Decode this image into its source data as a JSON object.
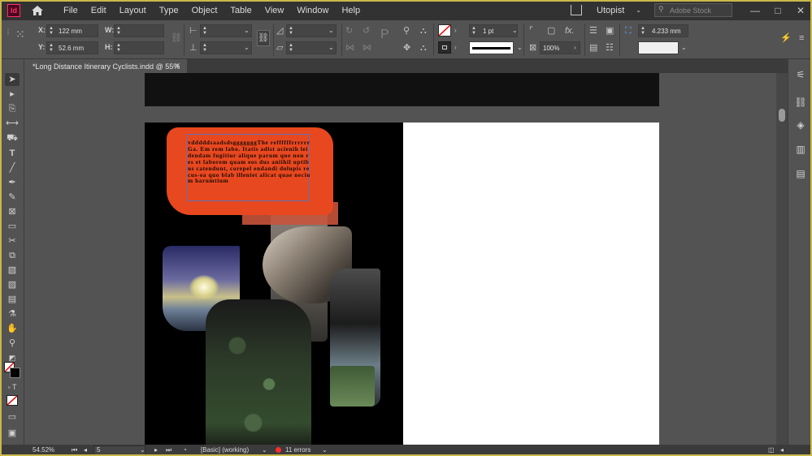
{
  "app": {
    "logo": "Id"
  },
  "menus": [
    "File",
    "Edit",
    "Layout",
    "Type",
    "Object",
    "Table",
    "View",
    "Window",
    "Help"
  ],
  "menubar_right": {
    "workspace": "Utopist",
    "stock_search_placeholder": "Adobe Stock",
    "window_buttons": [
      "—",
      "□",
      "✕"
    ]
  },
  "control_bar": {
    "x_label": "X:",
    "x_value": "122 mm",
    "y_label": "Y:",
    "y_value": "52.6 mm",
    "w_label": "W:",
    "w_value": "",
    "h_label": "H:",
    "h_value": "",
    "stroke_weight": "1 pt",
    "scale_percent": "100%",
    "offset_value": "4.233 mm"
  },
  "tab": {
    "title": "*Long Distance Itinerary Cyclists.indd @ 55%",
    "close": "✕"
  },
  "document": {
    "body_text": "vdddddsaadsdsgggggggThe reffffffrrrrrrGa. Em rem labo. Itatis adist acienih leidendam fugitiur alique parum que non res et laborem quam eos dus aniihil uptibus catendunt, corepel endandi dolupis recus-ea quo blab illeniet alicat quae necium harumtium"
  },
  "status_bar": {
    "zoom": "54.52%",
    "page": "5",
    "preflight_profile": "[Basic] (working)",
    "errors": "11 errors"
  },
  "colors": {
    "accent_splash": "#e8481f",
    "error": "#ff2b2b",
    "frame_border": "#c9b84a"
  }
}
